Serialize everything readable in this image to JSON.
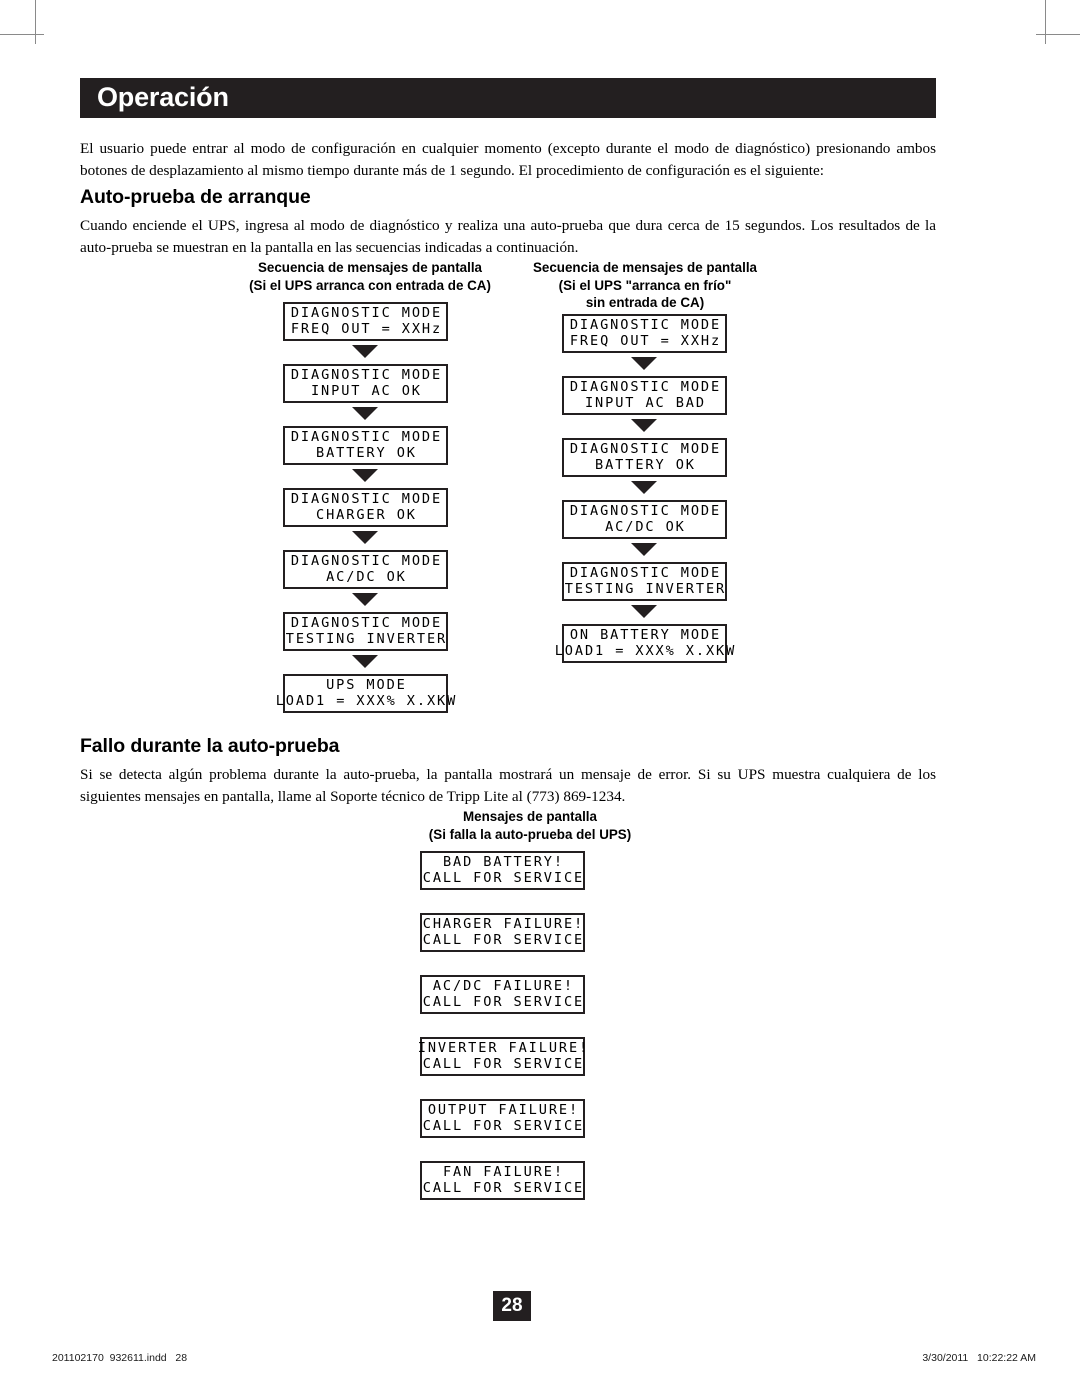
{
  "page": {
    "title": "Operación",
    "number": "28"
  },
  "intro": {
    "paragraph": "El usuario puede entrar al modo de configuración en cualquier momento (excepto durante el modo de diagnóstico) presionando ambos botones de desplazamiento al mismo tiempo durante más de 1 segundo. El procedimiento de configuración es el siguiente:"
  },
  "section_selftest": {
    "heading": "Auto-prueba de arranque",
    "paragraph": "Cuando enciende el UPS, ingresa al modo de diagnóstico y realiza una auto-prueba que dura cerca de 15 segundos. Los resultados de la auto-prueba se muestran en la pantalla en las secuencias indicadas a continuación."
  },
  "flow_left": {
    "heading_line1": "Secuencia de mensajes de pantalla",
    "heading_line2": "(Si el UPS arranca con entrada de CA)",
    "boxes": [
      {
        "line1": "DIAGNOSTIC MODE",
        "line2": "FREQ OUT = XXHz"
      },
      {
        "line1": "DIAGNOSTIC MODE",
        "line2": "INPUT AC OK"
      },
      {
        "line1": "DIAGNOSTIC MODE",
        "line2": "BATTERY OK"
      },
      {
        "line1": "DIAGNOSTIC MODE",
        "line2": "CHARGER OK"
      },
      {
        "line1": "DIAGNOSTIC MODE",
        "line2": "AC/DC OK"
      },
      {
        "line1": "DIAGNOSTIC MODE",
        "line2": "TESTING INVERTER"
      },
      {
        "line1": "UPS MODE",
        "line2": "LOAD1 = XXX% X.XKW"
      }
    ]
  },
  "flow_right": {
    "heading_line1": "Secuencia de mensajes de pantalla",
    "heading_line2": "(Si el UPS \"arranca en frío\"",
    "heading_line3": "sin entrada de CA)",
    "boxes": [
      {
        "line1": "DIAGNOSTIC MODE",
        "line2": "FREQ OUT = XXHz"
      },
      {
        "line1": "DIAGNOSTIC MODE",
        "line2": "INPUT AC BAD"
      },
      {
        "line1": "DIAGNOSTIC MODE",
        "line2": "BATTERY OK"
      },
      {
        "line1": "DIAGNOSTIC MODE",
        "line2": "AC/DC OK"
      },
      {
        "line1": "DIAGNOSTIC MODE",
        "line2": "TESTING INVERTER"
      },
      {
        "line1": "ON BATTERY MODE",
        "line2": "LOAD1 = XXX% X.XKW"
      }
    ]
  },
  "section_failure": {
    "heading": "Fallo durante la auto-prueba",
    "paragraph": "Si se detecta algún problema durante la auto-prueba, la pantalla mostrará un mensaje de error. Si su UPS muestra cualquiera de los siguientes mensajes en pantalla, llame al Soporte técnico de Tripp Lite al (773) 869-1234."
  },
  "error_messages": {
    "heading_line1": "Mensajes de pantalla",
    "heading_line2": "(Si falla la auto-prueba del UPS)",
    "boxes": [
      {
        "line1": "BAD BATTERY!",
        "line2": "CALL FOR SERVICE"
      },
      {
        "line1": "CHARGER FAILURE!",
        "line2": "CALL FOR SERVICE"
      },
      {
        "line1": "AC/DC FAILURE!",
        "line2": "CALL FOR SERVICE"
      },
      {
        "line1": "INVERTER FAILURE!",
        "line2": "CALL FOR SERVICE"
      },
      {
        "line1": "OUTPUT FAILURE!",
        "line2": "CALL FOR SERVICE"
      },
      {
        "line1": "FAN FAILURE!",
        "line2": "CALL FOR SERVICE"
      }
    ]
  },
  "footer": {
    "left": "201102170  932611.indd   28",
    "right": "3/30/2011   10:22:22 AM"
  },
  "colors": {
    "header_bar": "#231f20",
    "text": "#000000",
    "crop_mark": "#8a8a8a"
  }
}
